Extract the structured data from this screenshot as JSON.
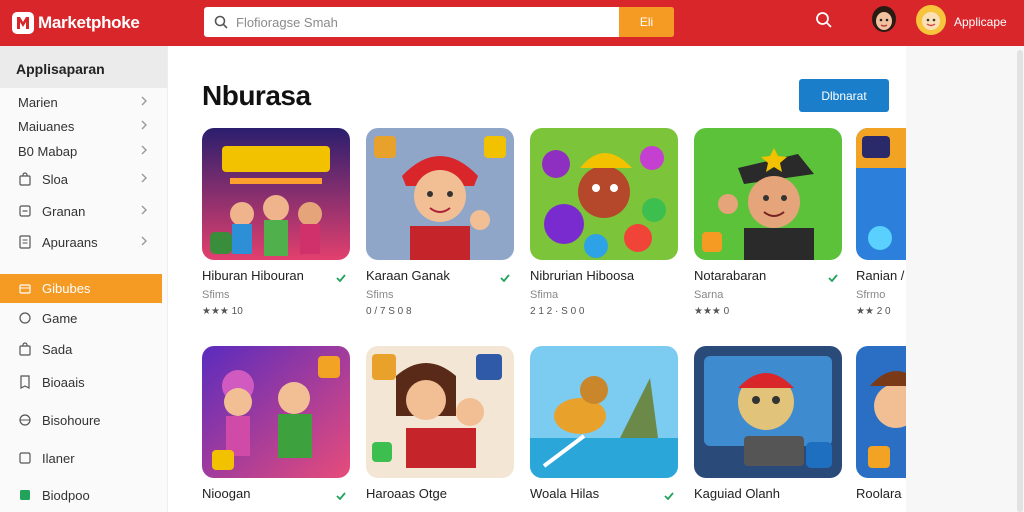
{
  "header": {
    "brand": "Marketphoke",
    "search_placeholder": "Flofioragse Smah",
    "search_button": "Eli",
    "user_label": "Applicape"
  },
  "sidebar": {
    "title": "Applisaparan",
    "items": [
      {
        "label": "Marien",
        "icon": "none",
        "chevron": true
      },
      {
        "label": "Maiuanes",
        "icon": "none",
        "chevron": true
      },
      {
        "label": "B0  Mabap",
        "icon": "none",
        "chevron": true
      },
      {
        "label": "Sloa",
        "icon": "bag-icon",
        "chevron": true
      },
      {
        "label": "Granan",
        "icon": "square-icon",
        "chevron": true
      },
      {
        "label": "Apuraans",
        "icon": "list-icon",
        "chevron": true
      },
      {
        "label": "Gibubes",
        "icon": "box-icon",
        "chevron": false,
        "active": true
      },
      {
        "label": "Game",
        "icon": "circle-icon",
        "chevron": false
      },
      {
        "label": "Sada",
        "icon": "bag-icon",
        "chevron": false
      },
      {
        "label": "Bioaais",
        "icon": "ticket-icon",
        "chevron": false
      },
      {
        "label": "Bisohoure",
        "icon": "globe-icon",
        "chevron": false
      },
      {
        "label": "Ilaner",
        "icon": "square-icon",
        "chevron": false
      },
      {
        "label": "Biodpoo",
        "icon": "green-square-icon",
        "chevron": false
      }
    ]
  },
  "main": {
    "title": "Nburasa",
    "action_button": "Dlbnarat"
  },
  "cards": [
    {
      "title": "Hiburan Hibouran",
      "sub": "Sfims",
      "rating": "★★★ 10"
    },
    {
      "title": "Karaan Ganak",
      "sub": "Sfims",
      "rating": "0 / 7 S 0 8"
    },
    {
      "title": "Nibrurian Hiboosa",
      "sub": "Sfima",
      "rating": "2 1 2 · S 0 0"
    },
    {
      "title": "Notarabaran",
      "sub": "Sarna",
      "rating": "★★★ 0"
    },
    {
      "title": "Ranian /",
      "sub": "Sfrmo",
      "rating": "★★ 2 0"
    },
    {
      "title": "Nioogan",
      "sub": "",
      "rating": ""
    },
    {
      "title": "Haroaas Otge",
      "sub": "",
      "rating": ""
    },
    {
      "title": "Woala Hilas",
      "sub": "",
      "rating": ""
    },
    {
      "title": "Kaguiad Olanh",
      "sub": "",
      "rating": ""
    },
    {
      "title": "Roolara",
      "sub": "",
      "rating": ""
    }
  ],
  "colors": {
    "header": "#d8262b",
    "accent": "#f59a23",
    "primary": "#1a7ecb",
    "verified": "#21a35b"
  }
}
